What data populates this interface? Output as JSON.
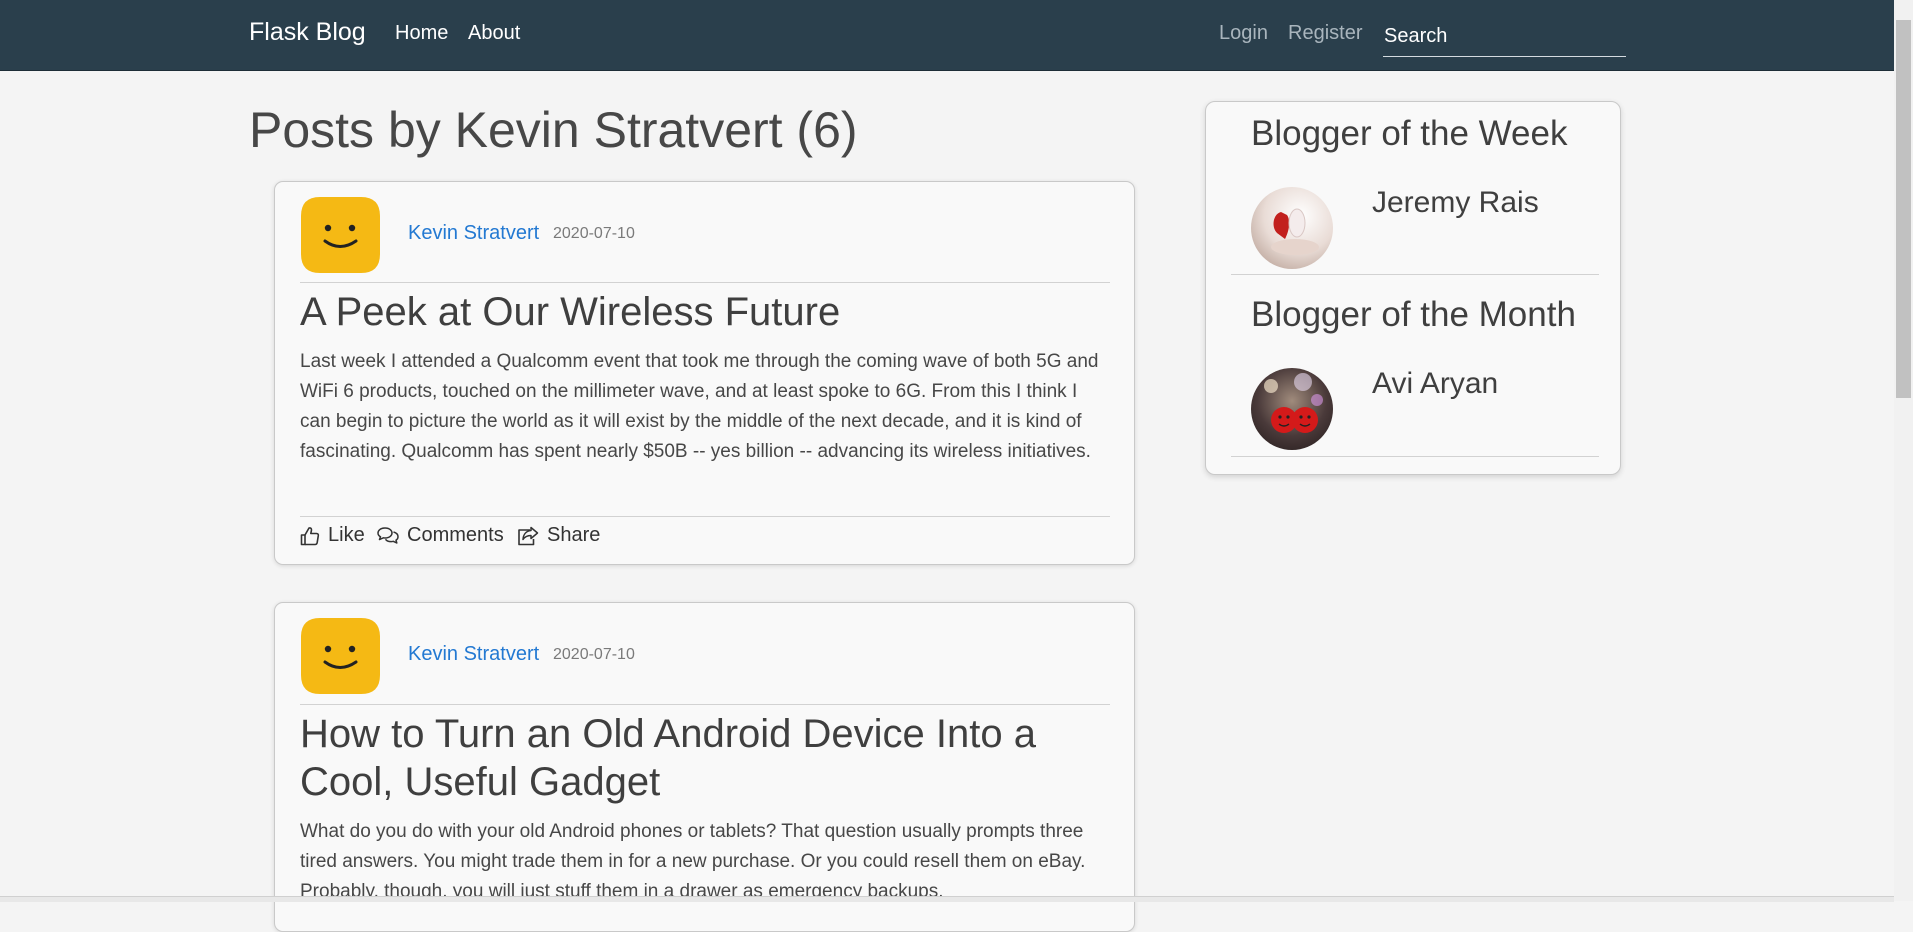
{
  "nav": {
    "brand": "Flask Blog",
    "home": "Home",
    "about": "About",
    "login": "Login",
    "register": "Register",
    "search_placeholder": "Search"
  },
  "page": {
    "title": "Posts by Kevin Stratvert (6)"
  },
  "posts": [
    {
      "author": "Kevin Stratvert",
      "date": "2020-07-10",
      "title": "A Peek at Our Wireless Future",
      "body": "Last week I attended a Qualcomm event that took me through the coming wave of both 5G and WiFi 6 products, touched on the millimeter wave, and at least spoke to 6G. From this I think I can begin to picture the world as it will exist by the middle of the next decade, and it is kind of fascinating. Qualcomm has spent nearly $50B -- yes billion -- advancing its wireless initiatives.",
      "actions": {
        "like": "Like",
        "comments": "Comments",
        "share": "Share"
      }
    },
    {
      "author": "Kevin Stratvert",
      "date": "2020-07-10",
      "title": "How to Turn an Old Android Device Into a Cool, Useful Gadget",
      "body": "What do you do with your old Android phones or tablets? That question usually prompts three tired answers. You might trade them in for a new purchase. Or you could resell them on eBay. Probably, though, you will just stuff them in a drawer as emergency backups."
    }
  ],
  "sidebar": {
    "week_heading": "Blogger of the Week",
    "week_name": "Jeremy Rais",
    "month_heading": "Blogger of the Month",
    "month_name": "Avi Aryan"
  },
  "colors": {
    "navbar": "#2a3f4c",
    "link": "#2379d2",
    "avatar": "#f5b914"
  },
  "icons": {
    "like": "thumbs-up-icon",
    "comments": "comments-icon",
    "share": "share-icon"
  }
}
